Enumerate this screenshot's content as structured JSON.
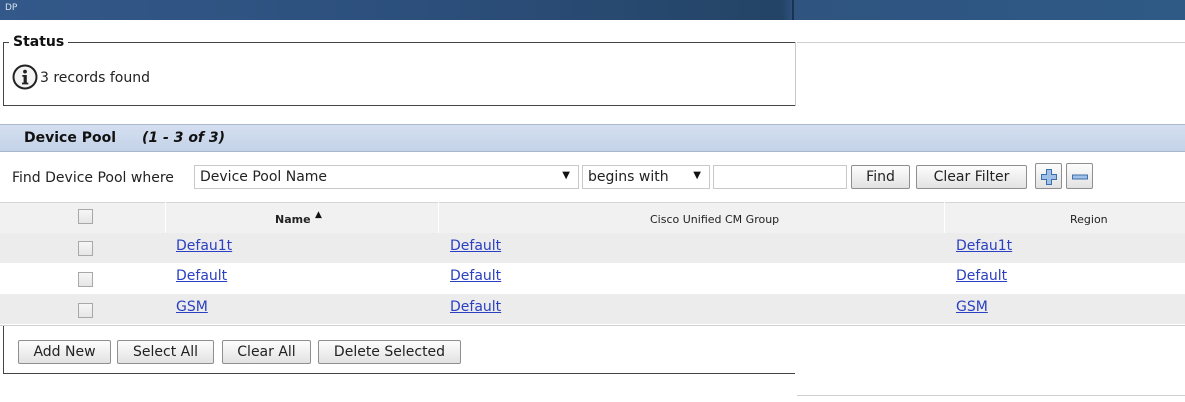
{
  "window": {
    "title": "DP"
  },
  "status": {
    "legend": "Status",
    "icon": "info-icon",
    "message": "3 records found"
  },
  "section": {
    "title": "Device Pool",
    "count": "(1 - 3 of 3)"
  },
  "find": {
    "label": "Find Device Pool where",
    "field_selected": "Device Pool Name",
    "operator_selected": "begins with",
    "search_value": "",
    "find_label": "Find",
    "clear_filter_label": "Clear Filter",
    "add_icon": "plus-icon",
    "remove_icon": "minus-icon"
  },
  "table": {
    "columns": [
      "Name",
      "Cisco Unified CM Group",
      "Region"
    ],
    "sort_column": "Name",
    "sort_direction": "ascending",
    "rows": [
      {
        "name": "Defau1t",
        "cm_group": "Default",
        "region": "Defau1t"
      },
      {
        "name": "Default",
        "cm_group": "Default",
        "region": "Default"
      },
      {
        "name": "GSM",
        "cm_group": "Default",
        "region": "GSM"
      }
    ]
  },
  "actions": {
    "add_new": "Add New",
    "select_all": "Select All",
    "clear_all": "Clear All",
    "delete_selected": "Delete Selected"
  },
  "colors": {
    "title_bar": "#2c4f7c",
    "section_header": "#c8d5ea",
    "link": "#2a3fc1"
  }
}
